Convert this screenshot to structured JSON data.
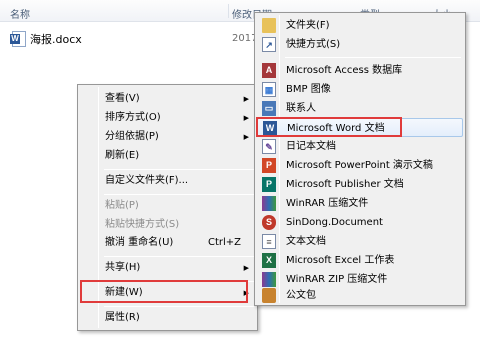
{
  "explorer": {
    "columns": [
      "名称",
      "修改日期",
      "类型",
      "大小"
    ],
    "file": {
      "name": "海报.docx",
      "date_partial": "2017"
    }
  },
  "context_menu": {
    "items": [
      {
        "label": "查看(V)",
        "submenu": true
      },
      {
        "label": "排序方式(O)",
        "submenu": true
      },
      {
        "label": "分组依据(P)",
        "submenu": true
      },
      {
        "label": "刷新(E)"
      },
      {
        "label": "自定义文件夹(F)..."
      },
      {
        "label": "粘贴(P)",
        "disabled": true
      },
      {
        "label": "粘贴快捷方式(S)",
        "disabled": true
      },
      {
        "label": "撤消 重命名(U)",
        "shortcut": "Ctrl+Z"
      },
      {
        "label": "共享(H)",
        "submenu": true
      },
      {
        "label": "新建(W)",
        "submenu": true,
        "highlighted": true
      },
      {
        "label": "属性(R)"
      }
    ]
  },
  "new_submenu": {
    "items": [
      {
        "label": "文件夹(F)",
        "icon": "folder-icon"
      },
      {
        "label": "快捷方式(S)",
        "icon": "shortcut-icon"
      },
      {
        "label": "Microsoft Access 数据库",
        "icon": "access-icon"
      },
      {
        "label": "BMP 图像",
        "icon": "bmp-image-icon"
      },
      {
        "label": "联系人",
        "icon": "contact-icon"
      },
      {
        "label": "Microsoft Word 文档",
        "icon": "word-icon",
        "highlighted": true
      },
      {
        "label": "日记本文档",
        "icon": "journal-icon"
      },
      {
        "label": "Microsoft PowerPoint 演示文稿",
        "icon": "powerpoint-icon"
      },
      {
        "label": "Microsoft Publisher 文档",
        "icon": "publisher-icon"
      },
      {
        "label": "WinRAR 压缩文件",
        "icon": "winrar-icon"
      },
      {
        "label": "SinDong.Document",
        "icon": "sindong-icon"
      },
      {
        "label": "文本文档",
        "icon": "text-document-icon"
      },
      {
        "label": "Microsoft Excel 工作表",
        "icon": "excel-icon"
      },
      {
        "label": "WinRAR ZIP 压缩文件",
        "icon": "winrar-zip-icon"
      },
      {
        "label": "公文包",
        "icon": "briefcase-icon"
      }
    ]
  },
  "colors": {
    "highlight_box": "#e03b3b",
    "menu_bg": "#f0f0f0",
    "hover_border": "#a8c8ea"
  }
}
